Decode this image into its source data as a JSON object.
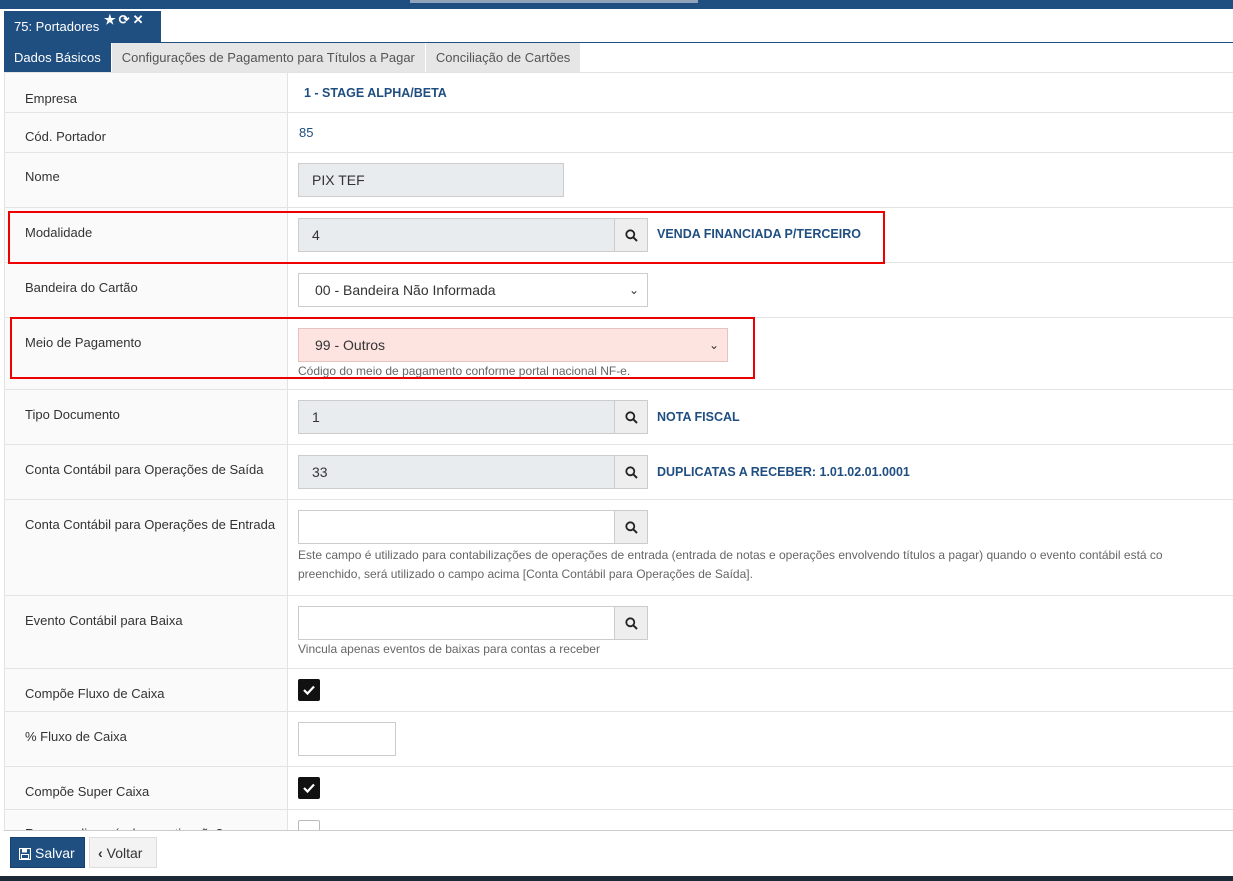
{
  "window": {
    "title": "75: Portadores",
    "icons": [
      "star-icon",
      "refresh-icon",
      "close-icon"
    ]
  },
  "tabs": [
    {
      "label": "Dados Básicos",
      "active": true
    },
    {
      "label": "Configurações de Pagamento para Títulos a Pagar",
      "active": false
    },
    {
      "label": "Conciliação de Cartões",
      "active": false
    }
  ],
  "form": {
    "empresa": {
      "label": "Empresa",
      "value": "1 - STAGE ALPHA/BETA"
    },
    "cod_portador": {
      "label": "Cód. Portador",
      "value": "85"
    },
    "nome": {
      "label": "Nome",
      "value": "PIX TEF"
    },
    "modalidade": {
      "label": "Modalidade",
      "value": "4",
      "description": "VENDA FINANCIADA P/TERCEIRO"
    },
    "bandeira": {
      "label": "Bandeira do Cartão",
      "selected": "00 - Bandeira Não Informada"
    },
    "meio_pagamento": {
      "label": "Meio de Pagamento",
      "selected": "99 - Outros",
      "help": "Código do meio de pagamento conforme portal nacional NF-e."
    },
    "tipo_documento": {
      "label": "Tipo Documento",
      "value": "1",
      "description": "NOTA FISCAL"
    },
    "conta_saida": {
      "label": "Conta Contábil para Operações de Saída",
      "value": "33",
      "description": "DUPLICATAS A RECEBER: 1.01.02.01.0001"
    },
    "conta_entrada": {
      "label": "Conta Contábil para Operações de Entrada",
      "value": "",
      "help_line1": "Este campo é utilizado para contabilizações de operações de entrada (entrada de notas e operações envolvendo títulos a pagar) quando o evento contábil está co",
      "help_line2": "preenchido, será utilizado o campo acima [Conta Contábil para Operações de Saída]."
    },
    "evento_baixa": {
      "label": "Evento Contábil para Baixa",
      "value": "",
      "help": "Vincula apenas eventos de baixas para contas a receber"
    },
    "compoe_fluxo": {
      "label": "Compõe Fluxo de Caixa",
      "checked": true
    },
    "pct_fluxo": {
      "label": "% Fluxo de Caixa",
      "value": ""
    },
    "compoe_super": {
      "label": "Compõe Super Caixa",
      "checked": true
    },
    "partial_row": {
      "label": "Recurso disponível sem ativação?",
      "checked": false
    }
  },
  "footer": {
    "save_label": "Salvar",
    "back_label": "Voltar"
  },
  "colors": {
    "primary": "#1f4e80",
    "highlight": "#e00000",
    "error_bg": "#fde4e1"
  }
}
